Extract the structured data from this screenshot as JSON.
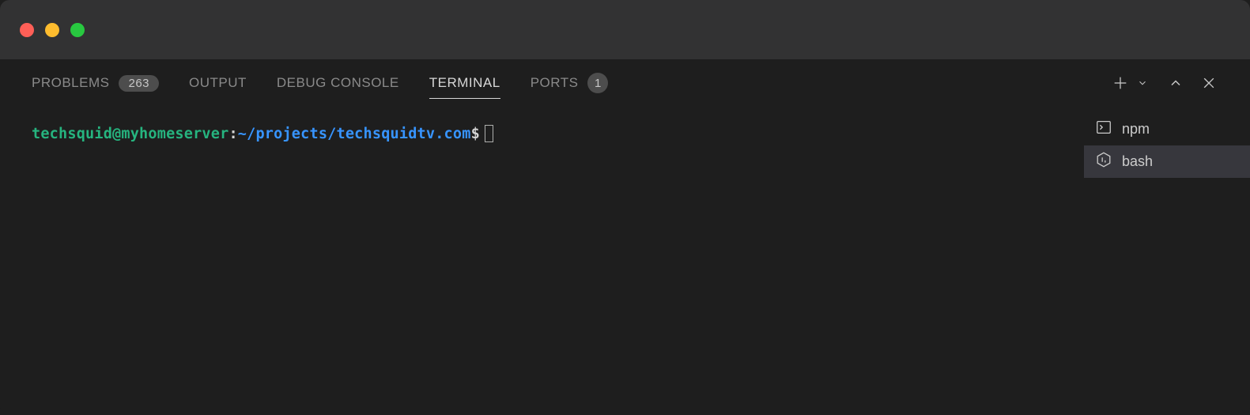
{
  "tabs": {
    "problems": {
      "label": "PROBLEMS",
      "badge": "263"
    },
    "output": {
      "label": "OUTPUT"
    },
    "debug_console": {
      "label": "DEBUG CONSOLE"
    },
    "terminal": {
      "label": "TERMINAL"
    },
    "ports": {
      "label": "PORTS",
      "badge": "1"
    }
  },
  "prompt": {
    "user_host": "techsquid@myhomeserver",
    "sep": ":",
    "path": "~/projects/techsquidtv.com",
    "dollar": "$"
  },
  "terminal_list": {
    "items": [
      {
        "label": "npm",
        "icon": "terminal-box"
      },
      {
        "label": "bash",
        "icon": "bash-hex"
      }
    ],
    "active_index": 1
  }
}
